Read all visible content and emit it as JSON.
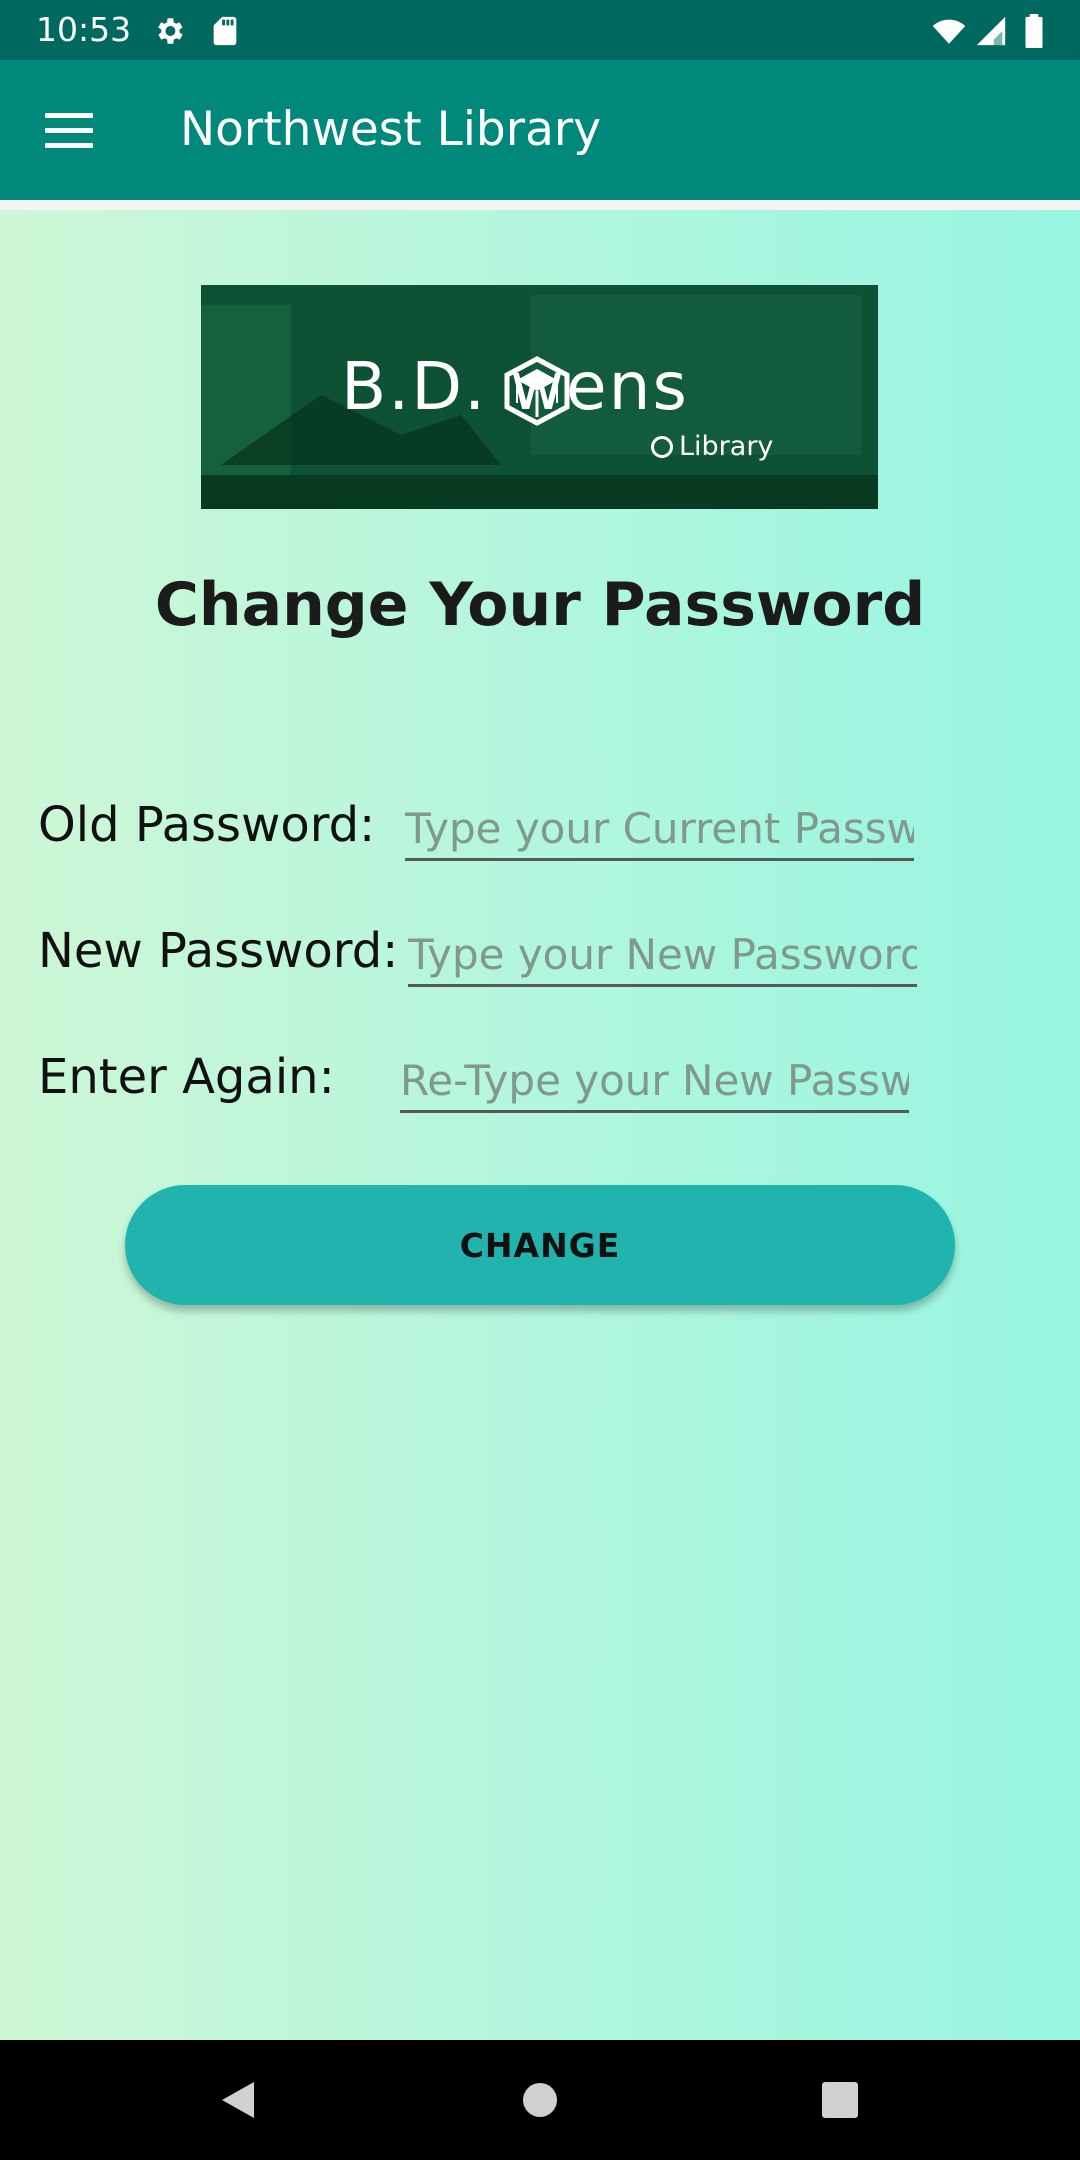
{
  "status_bar": {
    "time": "10:53",
    "icons": [
      "settings-icon",
      "sd-card-icon",
      "wifi-icon",
      "signal-icon",
      "battery-icon"
    ]
  },
  "app_bar": {
    "title": "Northwest Library",
    "menu_icon": "hamburger-menu-icon"
  },
  "banner": {
    "name": "B.D.    wens",
    "subtitle": "Library",
    "logo_icon": "owens-cube-logo"
  },
  "page": {
    "title": "Change Your Password"
  },
  "form": {
    "old_password": {
      "label": "Old Password:",
      "placeholder": "Type your Current Password",
      "value": ""
    },
    "new_password": {
      "label": "New Password:",
      "placeholder": "Type your New Password",
      "value": ""
    },
    "confirm_password": {
      "label": "Enter Again:",
      "placeholder": "Re-Type your New Password",
      "value": ""
    },
    "submit_label": "CHANGE"
  },
  "nav_bar": {
    "icons": [
      "back-icon",
      "home-icon",
      "recents-icon"
    ]
  },
  "colors": {
    "status_bar": "#00695f",
    "app_bar": "#00897b",
    "button": "#21b3ad",
    "gradient_start": "#cef7d6",
    "gradient_end": "#97f5e1"
  }
}
